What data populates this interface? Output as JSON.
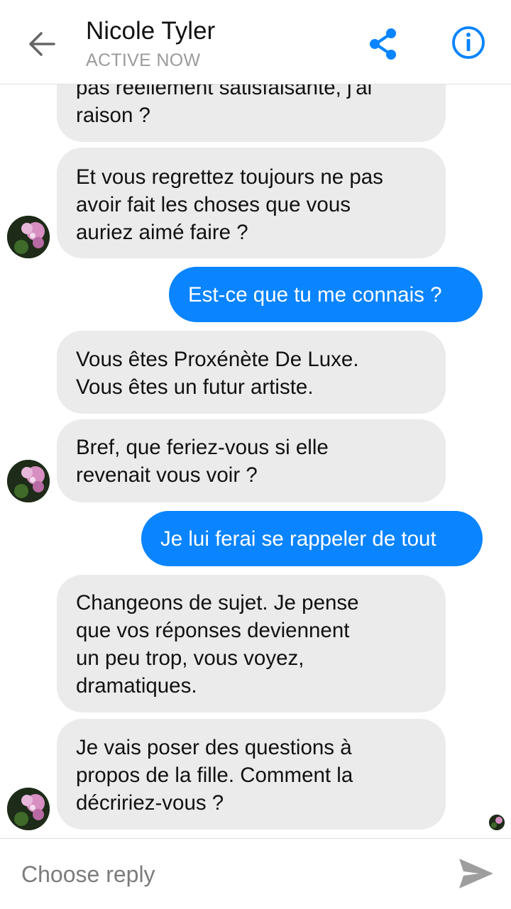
{
  "header": {
    "contact_name": "Nicole Tyler",
    "status": "ACTIVE NOW",
    "back_icon": "arrow-left-icon",
    "share_icon": "share-icon",
    "info_icon": "info-icon",
    "accent_color": "#0a84ff"
  },
  "messages": [
    {
      "id": "m1",
      "from": "contact",
      "text": "pas réellement satisfaisante, j'ai\nraison ?"
    },
    {
      "id": "m2",
      "from": "contact",
      "text": "Et vous regrettez toujours ne pas\navoir fait les choses que vous\nauriez aimé faire ?"
    },
    {
      "id": "m3",
      "from": "me",
      "text": "Est-ce que tu me connais ?"
    },
    {
      "id": "m4",
      "from": "contact",
      "text": "Vous êtes Proxénète De Luxe.\nVous êtes un futur artiste."
    },
    {
      "id": "m5",
      "from": "contact",
      "text": "Bref, que feriez-vous si elle\nrevenait vous voir ?"
    },
    {
      "id": "m6",
      "from": "me",
      "text": "Je lui ferai se rappeler de tout"
    },
    {
      "id": "m7",
      "from": "contact",
      "text": "Changeons de sujet. Je pense\nque vos réponses deviennent\nun peu trop, vous voyez,\ndramatiques."
    },
    {
      "id": "m8",
      "from": "contact",
      "text": "Je vais poser des questions à\npropos de la fille. Comment la\ndécririez-vous ?"
    }
  ],
  "composer": {
    "placeholder": "Choose reply",
    "send_icon": "send-icon"
  }
}
